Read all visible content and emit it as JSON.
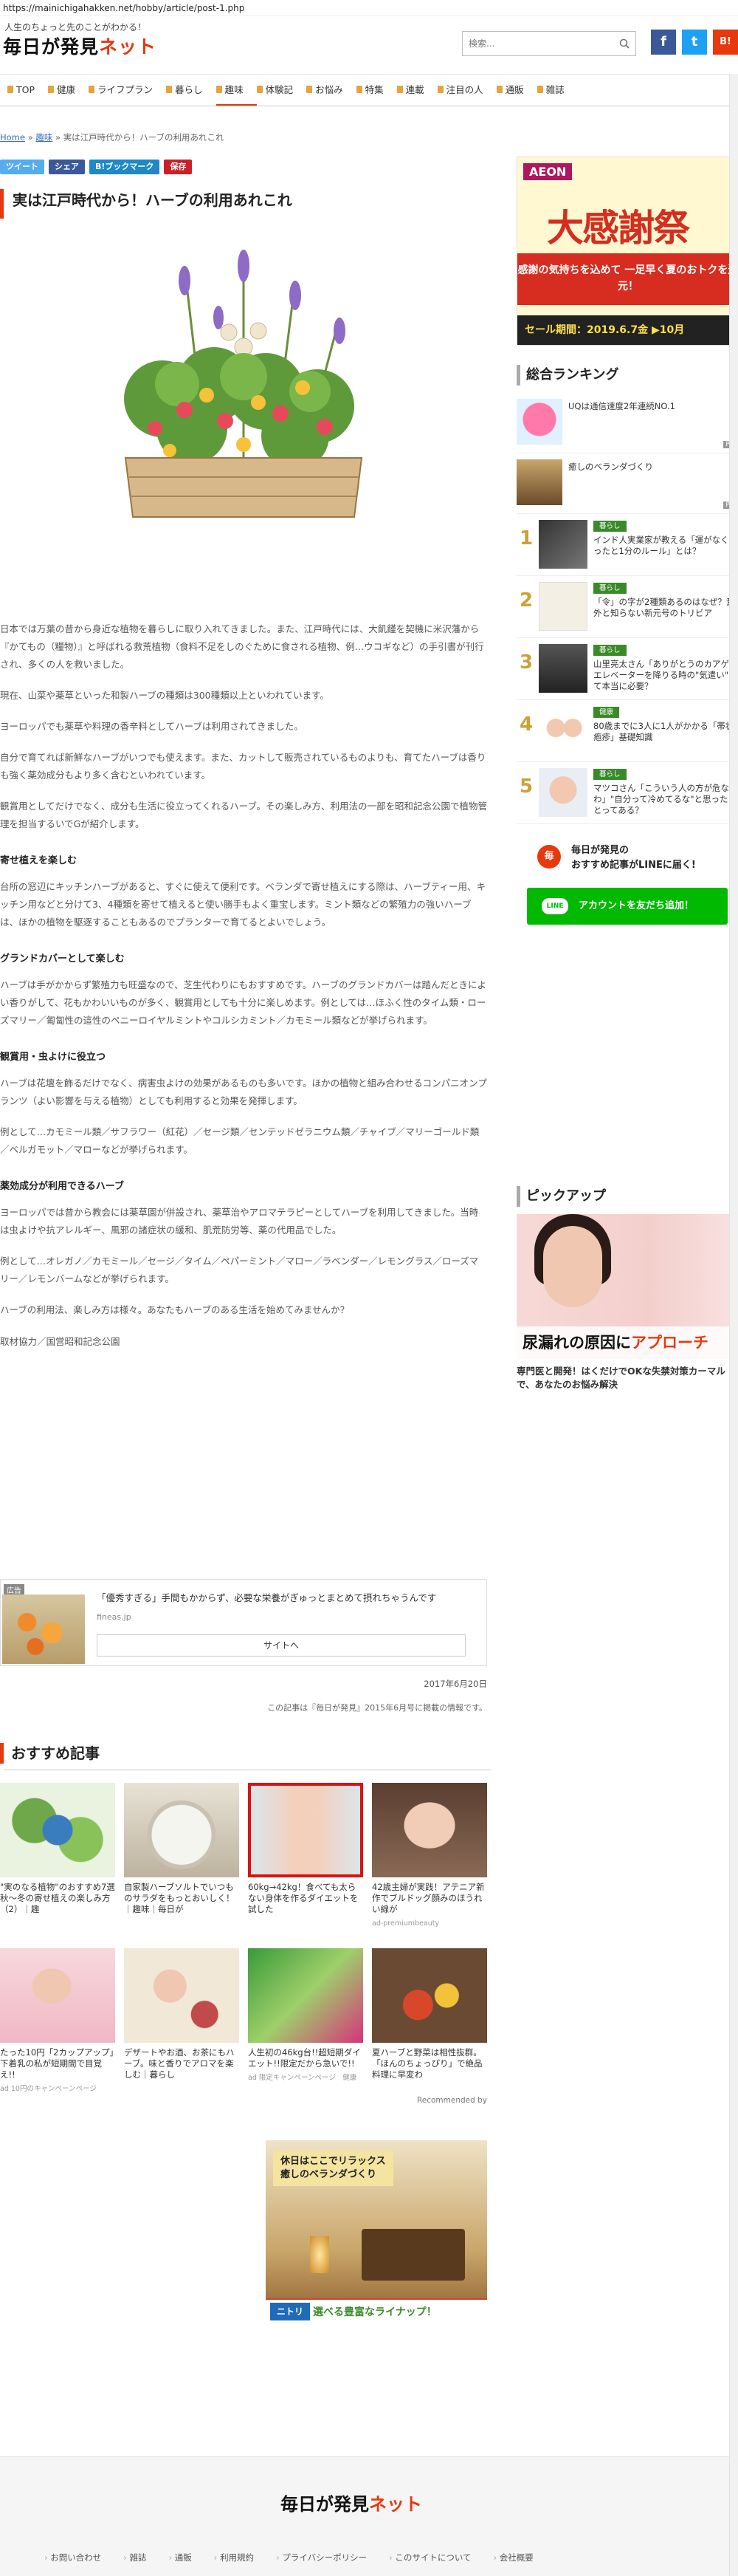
{
  "url": "https://mainichigahakken.net/hobby/article/post-1.php",
  "header": {
    "tagline": "人生のちょっと先のことがわかる！",
    "logo_main": "毎日が発見",
    "logo_tail": "ネット",
    "search_placeholder": "検索...",
    "social_fb": "f",
    "social_tw": "t",
    "social_hatena": "B!"
  },
  "nav": [
    "TOP",
    "健康",
    "ライフプラン",
    "暮らし",
    "趣味",
    "体験記",
    "お悩み",
    "特集",
    "連載",
    "注目の人",
    "通販",
    "雑誌"
  ],
  "breadcrumb": {
    "home": "Home",
    "sep": "»",
    "cat": "趣味",
    "current": "実は江戸時代から！ハーブの利用あれこれ"
  },
  "share": {
    "tweet": "ツイート",
    "fb": "シェア",
    "hatena": "B!ブックマーク",
    "save": "保存"
  },
  "article": {
    "title": "実は江戸時代から！ハーブの利用あれこれ",
    "paragraphs": [
      "日本では万葉の昔から身近な植物を暮らしに取り入れてきました。また、江戸時代には、大飢饉を契機に米沢藩から『かてもの（糧物）』と呼ばれる救荒植物（食料不足をしのぐために食される植物、例…ウコギなど）の手引書が刊行され、多くの人を救いました。",
      "現在、山菜や薬草といった和製ハーブの種類は300種類以上といわれています。",
      "ヨーロッパでも薬草や料理の香辛料としてハーブは利用されてきました。",
      "自分で育てれば新鮮なハーブがいつでも使えます。また、カットして販売されているものよりも、育てたハーブは香りも強く薬効成分もより多く含むといわれています。",
      "観賞用としてだけでなく、成分も生活に役立ってくれるハーブ。その楽しみ方、利用法の一部を昭和記念公園で植物管理を担当するいでGが紹介します。"
    ],
    "sections": [
      {
        "heading": "寄せ植えを楽しむ",
        "text": "台所の窓辺にキッチンハーブがあると、すぐに使えて便利です。ベランダで寄せ植えにする際は、ハーブティー用、キッチン用などと分けて3、4種類を寄せて植えると使い勝手もよく重宝します。ミント類などの繁殖力の強いハーブは、ほかの植物を駆逐することもあるのでプランターで育てるとよいでしょう。"
      },
      {
        "heading": "グランドカバーとして楽しむ",
        "text": "ハーブは手がかからず繁殖力も旺盛なので、芝生代わりにもおすすめです。ハーブのグランドカバーは踏んだときによい香りがして、花もかわいいものが多く、観賞用としても十分に楽しめます。例としては…ほふく性のタイム類・ローズマリー／匍匐性の這性のペニーロイヤルミントやコルシカミント／カモミール類などが挙げられます。"
      },
      {
        "heading": "観賞用・虫よけに役立つ",
        "text": "ハーブは花壇を飾るだけでなく、病害虫よけの効果があるものも多いです。ほかの植物と組み合わせるコンパニオンプランツ（よい影響を与える植物）としても利用すると効果を発揮します。"
      },
      {
        "heading": "",
        "text": "例として…カモミール類／サフラワー（紅花）／セージ類／センテッドゼラニウム類／チャイブ／マリーゴールド類／ベルガモット／マローなどが挙げられます。"
      },
      {
        "heading": "薬効成分が利用できるハーブ",
        "text": "ヨーロッパでは昔から教会には薬草園が併設され、薬草治やアロマテラピーとしてハーブを利用してきました。当時は虫よけや抗アレルギー、風邪の諸症状の緩和、肌荒防労等、薬の代用品でした。"
      },
      {
        "heading": "",
        "text": "例として…オレガノ／カモミール／セージ／タイム／ペパーミント／マロー／ラベンダー／レモングラス／ローズマリー／レモンバームなどが挙げられます。"
      },
      {
        "heading": "",
        "text": "ハーブの利用法、楽しみ方は様々。あなたもハーブのある生活を始めてみませんか？"
      }
    ],
    "credit": "取材協力／国営昭和記念公園"
  },
  "ad1": {
    "tag": "広告",
    "title": "「優秀すぎる」手間もかからず、必要な栄養がぎゅっとまとめて摂れちゃうんです",
    "source": "fineas.jp",
    "button": "サイトへ"
  },
  "pubdate": "2017年6月20日",
  "note": "この記事は『毎日が発見』2015年6月号に掲載の情報です。",
  "recommend": {
    "heading": "おすすめ記事",
    "cards": [
      {
        "text": "\"実のなる植物\"のおすすめ7選　秋〜冬の寄せ植えの楽しみ方（2）｜趣",
        "src": ""
      },
      {
        "text": "自家製ハーブソルトでいつものサラダをもっとおいしく！｜趣味｜毎日が",
        "src": ""
      },
      {
        "text": "60kg→42kg！食べても太らない身体を作るダイエットを試した",
        "src": ""
      },
      {
        "text": "42歳主婦が実践！アテニア新作でブルドッグ顔みのほうれい線が",
        "src": "ad-premiumbeauty"
      },
      {
        "text": "たった10円「2カップアップ」下着乳の私が短期間で目覚え!!",
        "src": "ad 10円のキャンペーンページ"
      },
      {
        "text": "デザートやお酒、お茶にもハーブ。味と香りでアロマを楽しむ｜暮らし",
        "src": ""
      },
      {
        "text": "人生初の46kg台!!超短期ダイエット!!限定だから急いで!!",
        "src": "ad 限定キャンペーンページ　健康"
      },
      {
        "text": "夏ハーブと野菜は相性抜群。「ほんのちょっぴり」で絶品料理に早変わ",
        "src": ""
      }
    ],
    "by": "Recommended by"
  },
  "ad2": {
    "line1": "休日はここでリラックス",
    "line2": "癒しのベランダづくり",
    "brand": "ニトリ",
    "cta": "選べる豊富なライナップ！"
  },
  "sidebar": {
    "aeon": {
      "brand": "AEON",
      "big": "大感謝祭",
      "red": "感謝の気持ちを込めて 一足早く夏のおトクを還元！",
      "foot": "セール期間：2019.6.7金 ▶10月"
    },
    "ranking_title": "総合ランキング",
    "pr": [
      {
        "text": "UQは通信速度2年連続NO.1",
        "pr": "PR"
      },
      {
        "text": "癒しのベランダづくり",
        "pr": "PR"
      }
    ],
    "ranks": [
      {
        "num": "1",
        "cat": "暮らし",
        "text": "インド人実業家が教える「運がなくなったと1分のルール」とは？"
      },
      {
        "num": "2",
        "cat": "暮らし",
        "text": "「令」の字が2種類あるのはなぜ？意外と知らない新元号のトリビア"
      },
      {
        "num": "3",
        "cat": "暮らし",
        "text": "山里亮太さん「ありがとうのカアゲ」エレベーターを降りる時の\"気遣い\"って本当に必要？"
      },
      {
        "num": "4",
        "cat": "健康",
        "text": "80歳までに3人に1人がかかる「帯状疱疹」基礎知識"
      },
      {
        "num": "5",
        "cat": "暮らし",
        "text": "マツコさん「こういう人の方が危ないわ」\"自分って冷めてるな\"と思ったことってある？"
      }
    ],
    "line": {
      "icon": "毎",
      "title": "毎日が発見の\nおすすめ記事がLINEに届く!",
      "button": "アカウントを友だち追加！"
    },
    "pickup_title": "ピックアップ",
    "pickup_overlay": "尿漏れの原因に",
    "pickup_overlay2": "アプローチ",
    "pickup_caption": "専門医と開発！はくだけでOKな失禁対策カーマルで、あなたのお悩み解決"
  },
  "footer": {
    "logo_main": "毎日が発見",
    "logo_tail": "ネット",
    "links": [
      "お問い合わせ",
      "雑誌",
      "通販",
      "利用規約",
      "プライバシーポリシー",
      "このサイトについて",
      "会社概要"
    ]
  },
  "colors": {
    "accent": "#e8380d",
    "line": "#00b900"
  }
}
